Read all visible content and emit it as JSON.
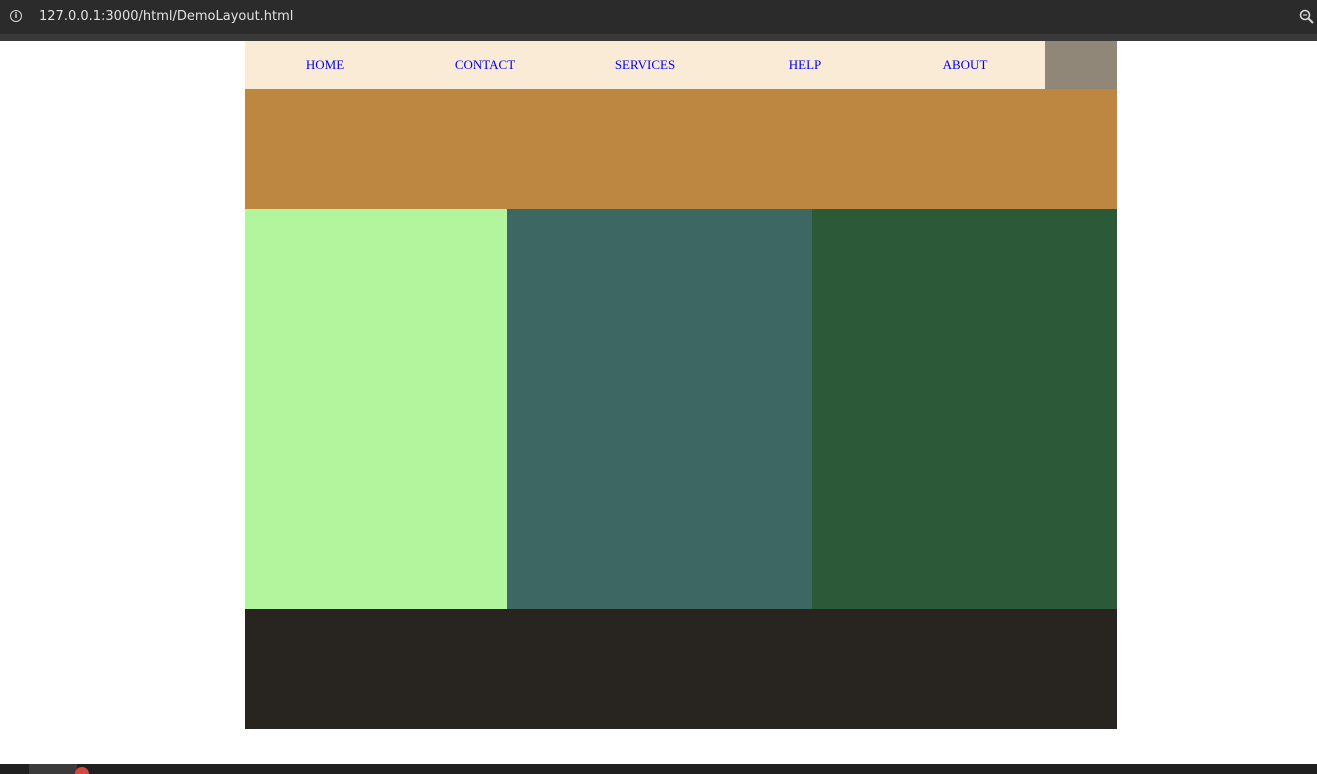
{
  "browser": {
    "url": "127.0.0.1:3000/html/DemoLayout.html",
    "icons": {
      "site_info": "info-icon",
      "zoom": "zoom-icon"
    }
  },
  "nav": {
    "items": [
      {
        "label": "HOME"
      },
      {
        "label": "CONTACT"
      },
      {
        "label": "SERVICES"
      },
      {
        "label": "HELP"
      },
      {
        "label": "ABOUT"
      }
    ]
  },
  "colors": {
    "nav_background": "#faebd7",
    "nav_link": "#0000ee",
    "nav_filler": "#918779",
    "header": "#be8741",
    "left_column": "#b2f59d",
    "middle_column": "#3d6763",
    "right_column": "#2c5938",
    "footer": "#282420"
  }
}
